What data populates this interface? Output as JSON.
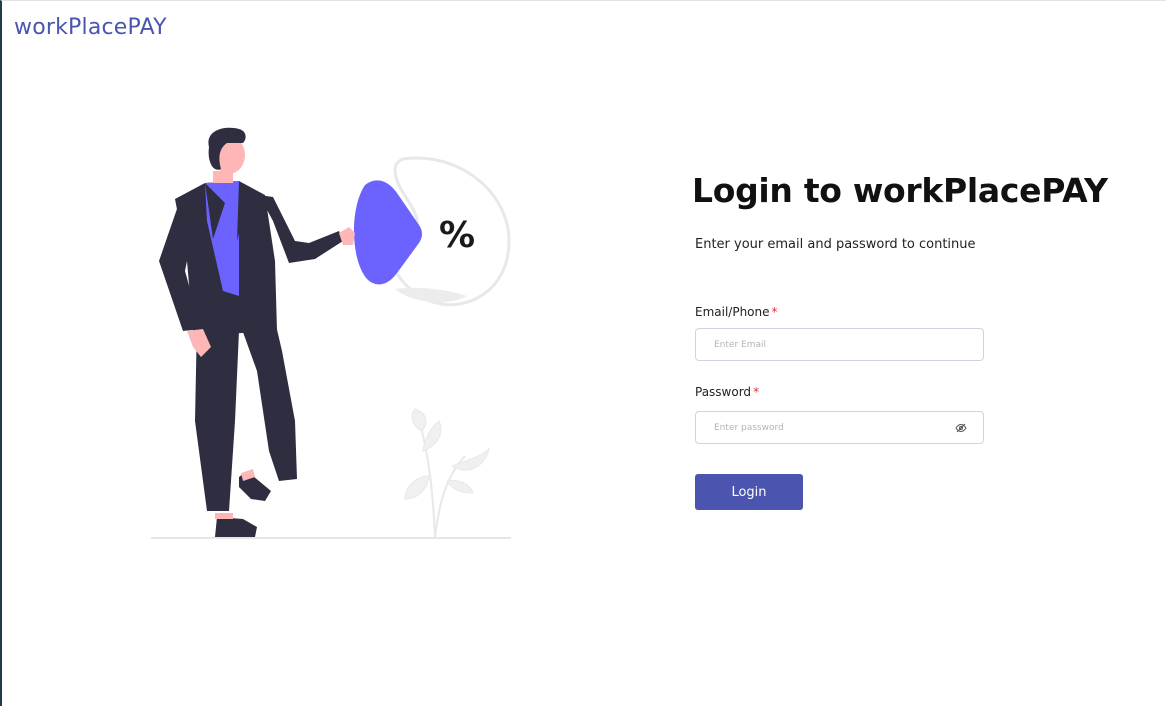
{
  "brand": {
    "name": "workPlacePAY"
  },
  "illustration": {
    "symbol": "%"
  },
  "login": {
    "title": "Login to workPlacePAY",
    "subtitle": "Enter your email and password to continue",
    "email": {
      "label": "Email/Phone",
      "required_mark": "*",
      "placeholder": "Enter Email",
      "value": ""
    },
    "password": {
      "label": "Password",
      "required_mark": "*",
      "placeholder": "Enter password",
      "value": "",
      "toggle_icon": "eye-off-icon"
    },
    "submit_label": "Login"
  },
  "colors": {
    "brand": "#4b55b0",
    "accent_illustration": "#6c63ff",
    "required": "#e03131"
  }
}
